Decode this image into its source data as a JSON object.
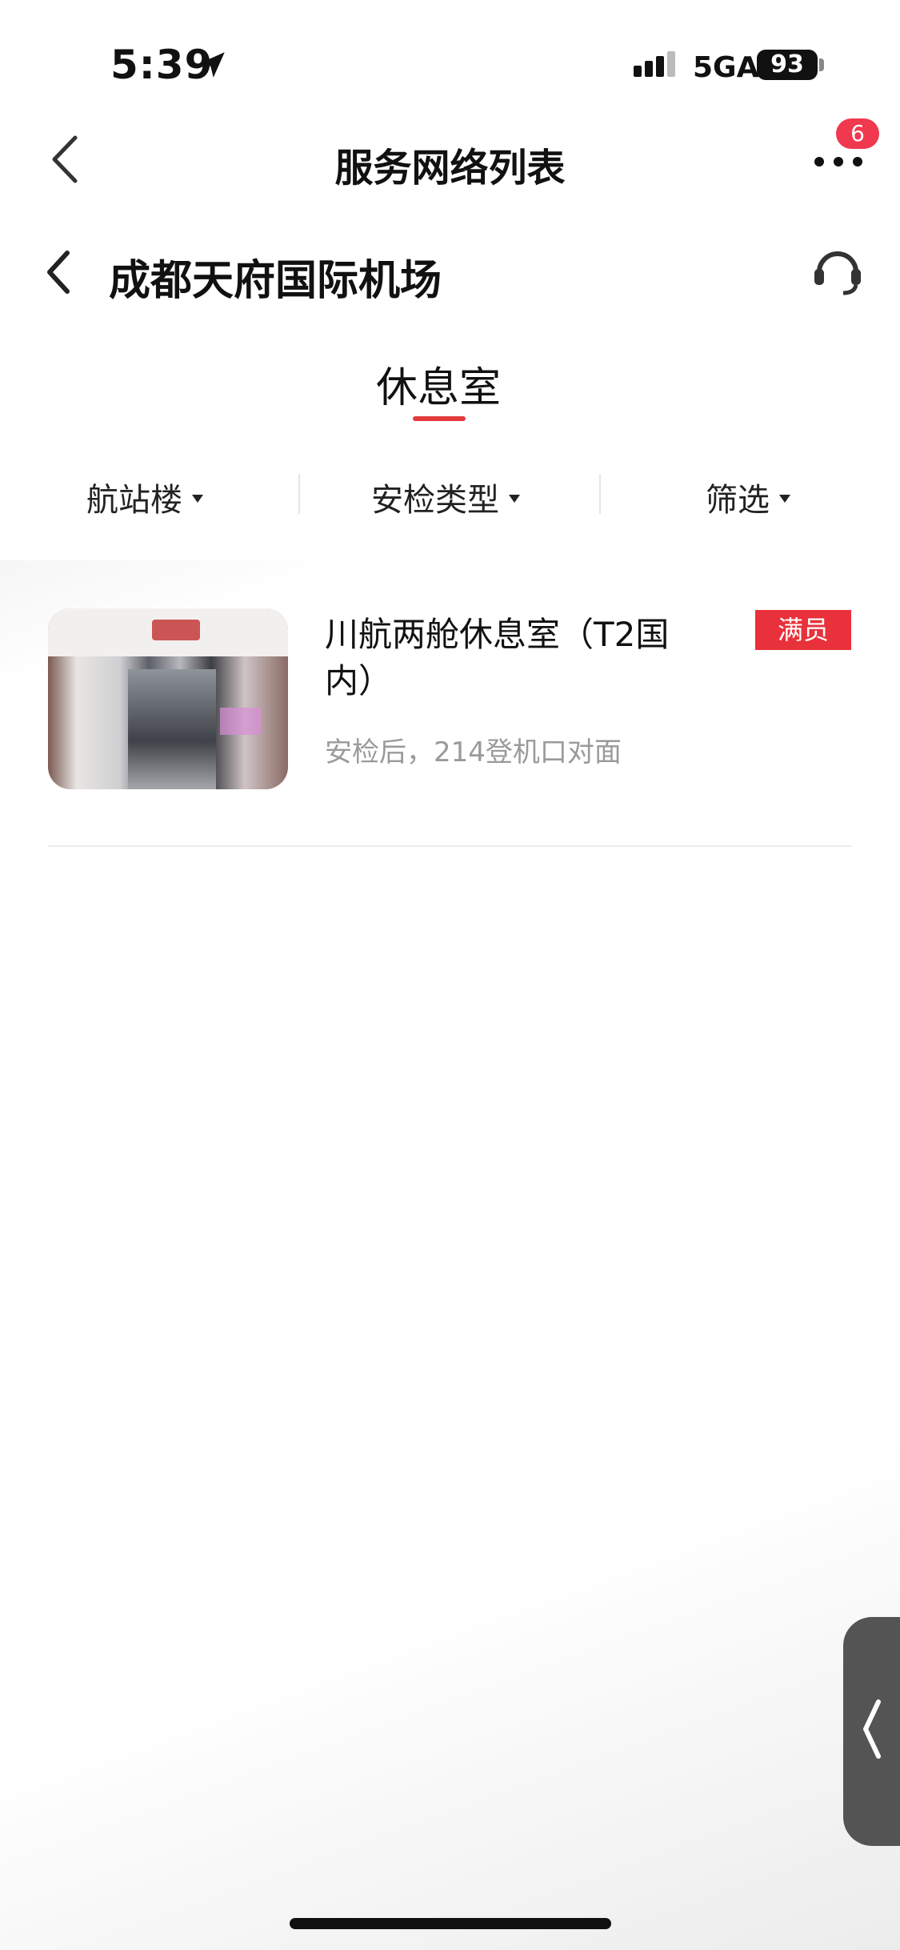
{
  "status_bar": {
    "time": "5:39",
    "network": "5GA",
    "battery": "93"
  },
  "nav": {
    "title": "服务网络列表",
    "badge": "6"
  },
  "airport": {
    "name": "成都天府国际机场"
  },
  "tab": {
    "label": "休息室"
  },
  "filters": [
    {
      "label": "航站楼"
    },
    {
      "label": "安检类型"
    },
    {
      "label": "筛选"
    }
  ],
  "items": [
    {
      "title": "川航两舱休息室（T2国内）",
      "location": "安检后，214登机口对面",
      "status": "满员"
    }
  ],
  "colors": {
    "accent": "#e43a3f",
    "tag": "#e8313a",
    "badge": "#f0384e"
  },
  "icons": [
    "location-arrow-icon",
    "signal-icon",
    "battery-icon",
    "back-chevron-icon",
    "more-dots-icon",
    "headset-icon",
    "caret-down-icon",
    "side-chevron-icon"
  ]
}
